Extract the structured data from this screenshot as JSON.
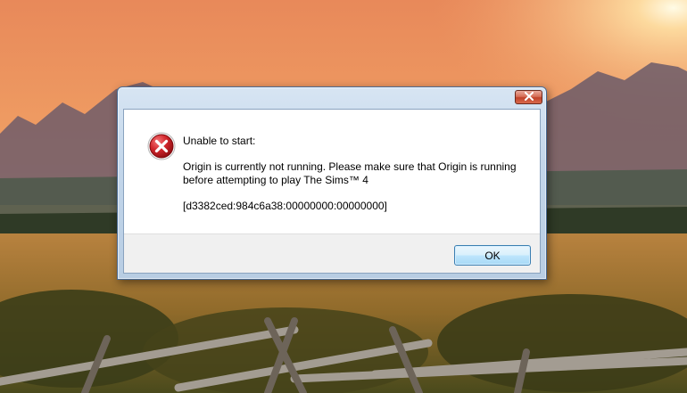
{
  "dialog": {
    "close_icon": "close-x-icon",
    "error_icon": "error-x-icon",
    "title": "Unable to start:",
    "message_line1": "Origin is currently not running. Please make sure that Origin is running",
    "message_line2": "before attempting to play The Sims™ 4",
    "error_code": "[d3382ced:984c6a38:00000000:00000000]",
    "ok_label": "OK"
  },
  "colors": {
    "accent_button": "#a7d9f5",
    "close_button": "#c0422a",
    "error_icon": "#c4161c"
  }
}
